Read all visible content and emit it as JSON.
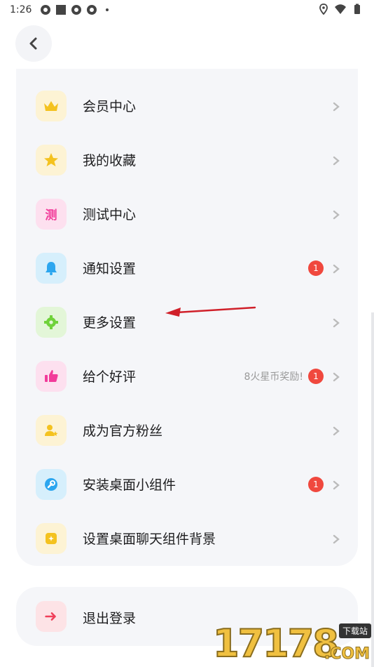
{
  "status_bar": {
    "time": "1:26"
  },
  "menu": {
    "items": [
      {
        "label": "会员中心",
        "icon": "crown-icon",
        "bg": "#fdf3d4",
        "color": "#f4c21f"
      },
      {
        "label": "我的收藏",
        "icon": "star-icon",
        "bg": "#fdf3d4",
        "color": "#f4c21f"
      },
      {
        "label": "测试中心",
        "icon": "test-icon",
        "glyph": "测",
        "bg": "#fde0ef",
        "color": "#f23b9a"
      },
      {
        "label": "通知设置",
        "icon": "bell-icon",
        "bg": "#d6effc",
        "color": "#2ca6ef",
        "badge": "1"
      },
      {
        "label": "更多设置",
        "icon": "gear-icon",
        "bg": "#e3f6d8",
        "color": "#6fd23a"
      },
      {
        "label": "给个好评",
        "icon": "thumbs-up-icon",
        "bg": "#fde0ef",
        "color": "#f23b9a",
        "badge": "1",
        "reward": "8火星币奖励!"
      },
      {
        "label": "成为官方粉丝",
        "icon": "fan-user-icon",
        "bg": "#fdf3d4",
        "color": "#f4c21f"
      },
      {
        "label": "安装桌面小组件",
        "icon": "wrench-icon",
        "bg": "#d6effc",
        "color": "#2ca6ef",
        "badge": "1"
      },
      {
        "label": "设置桌面聊天组件背景",
        "icon": "widget-icon",
        "bg": "#fdf3d4",
        "color": "#f4c21f"
      }
    ]
  },
  "logout": {
    "label": "退出登录",
    "icon": "exit-arrow-icon"
  },
  "watermark": {
    "digits": "17178",
    "tag": "下载站",
    "suffix": ".COM"
  }
}
